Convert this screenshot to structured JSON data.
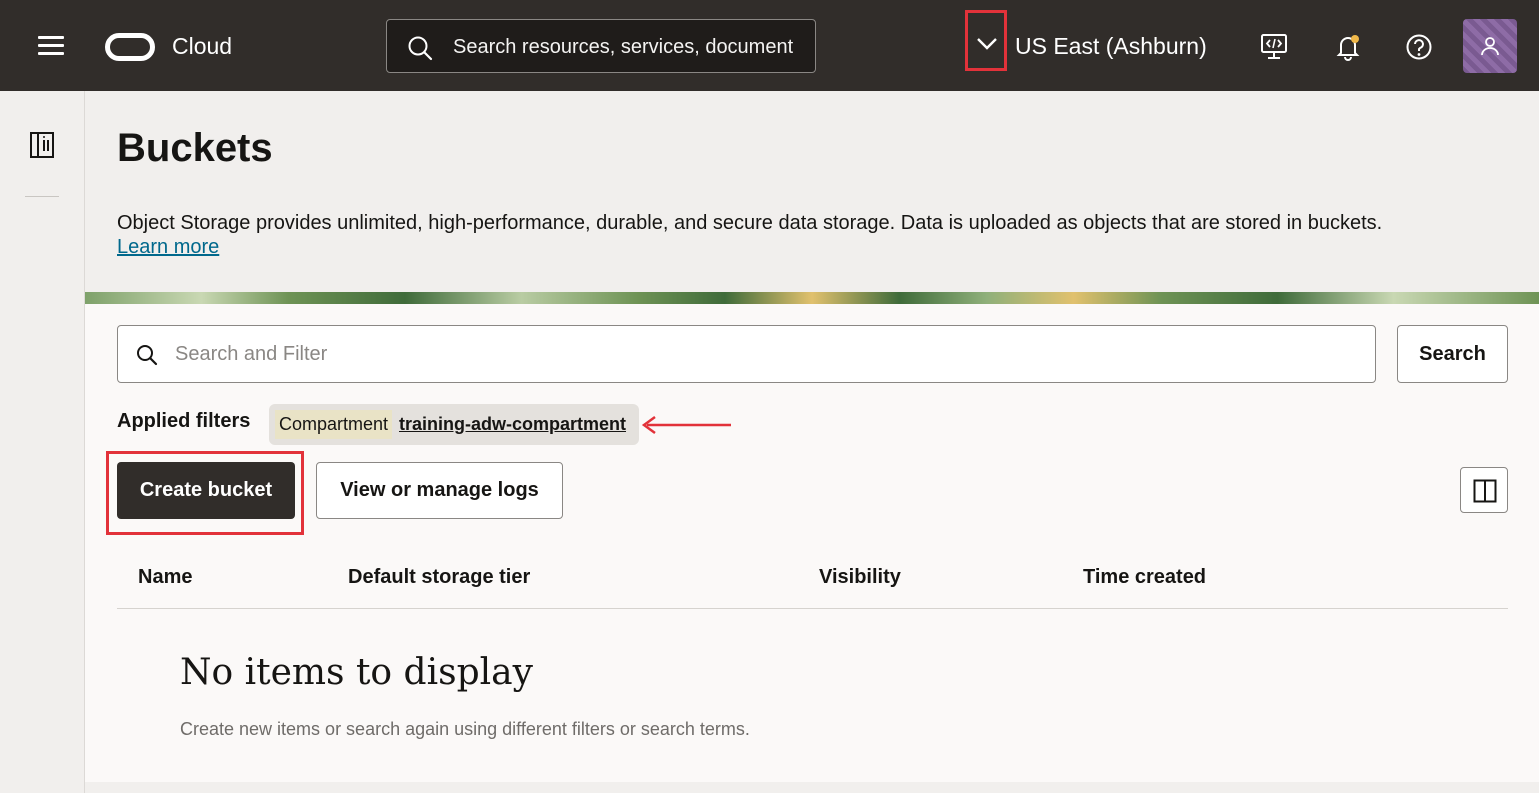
{
  "topbar": {
    "brand": "Cloud",
    "search_placeholder": "Search resources, services, documentation, and Marketplace",
    "region": "US East (Ashburn)",
    "icons": [
      "menu-icon",
      "oracle-logo",
      "search-icon",
      "chevron-down-icon",
      "code-editor-icon",
      "bell-icon",
      "help-icon",
      "user-icon"
    ]
  },
  "page": {
    "title": "Buckets",
    "description": "Object Storage provides unlimited, high-performance, durable, and secure data storage. Data is uploaded as objects that are stored in buckets.",
    "learn_more": "Learn more"
  },
  "filters": {
    "search_placeholder": "Search and Filter",
    "search_button": "Search",
    "applied_label": "Applied filters",
    "chip_key": "Compartment",
    "chip_value": "training-adw-compartment"
  },
  "actions": {
    "create": "Create bucket",
    "logs": "View or manage logs"
  },
  "table": {
    "columns": [
      "Name",
      "Default storage tier",
      "Visibility",
      "Time created"
    ],
    "empty_title": "No items to display",
    "empty_subtitle": "Create new items or search again using different filters or search terms."
  },
  "colors": {
    "topbar": "#312d2a",
    "highlight": "#e2323a",
    "link": "#00688c",
    "primary_button": "#312d2a"
  }
}
